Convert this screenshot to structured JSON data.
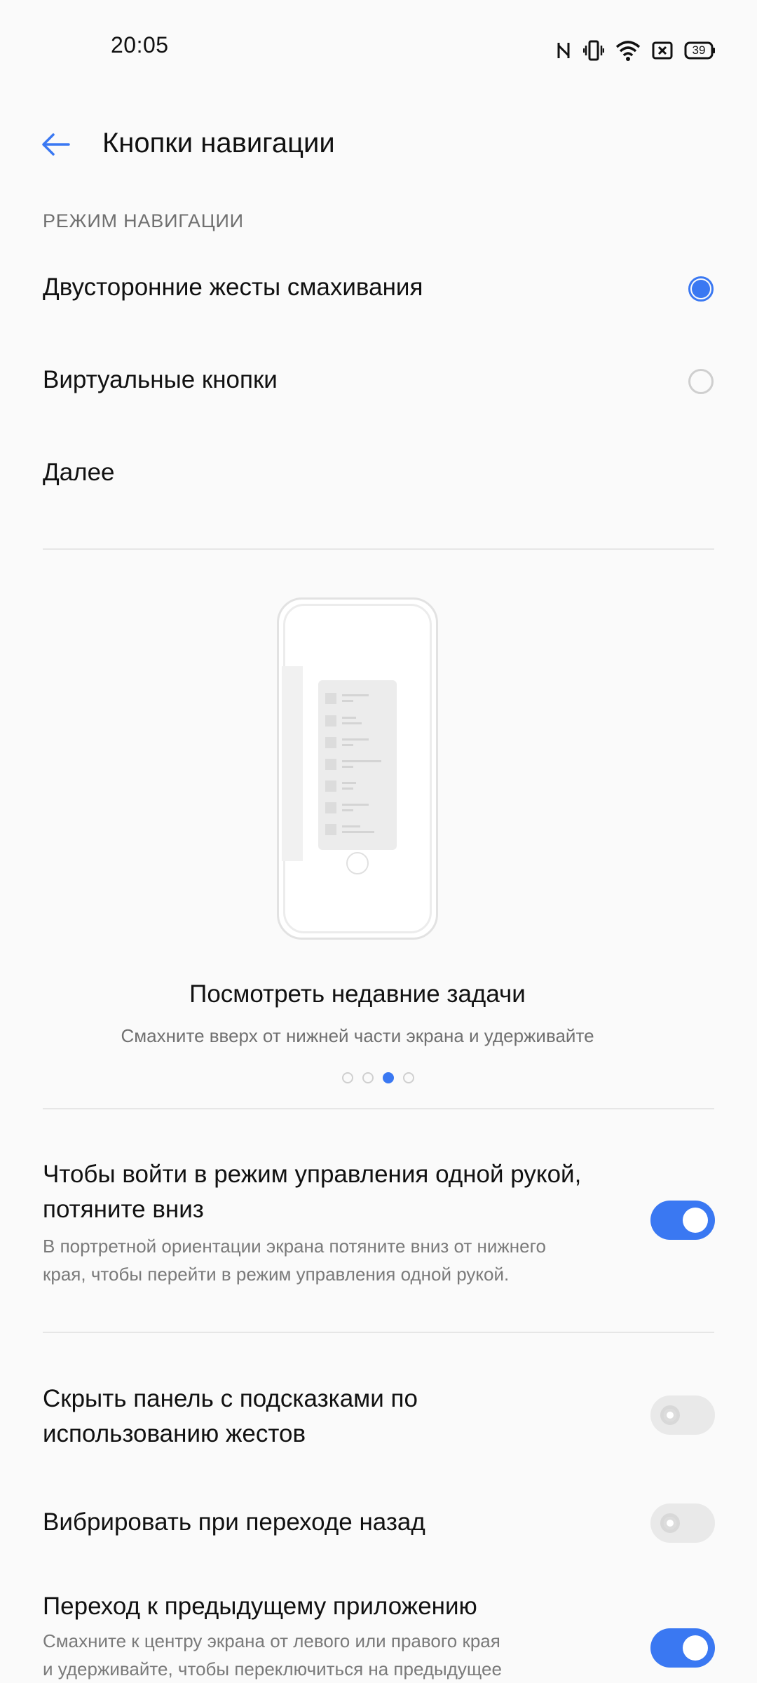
{
  "status": {
    "time": "20:05",
    "battery": "39",
    "icons": [
      "nfc-icon",
      "vibrate-icon",
      "wifi-icon",
      "sim-icon",
      "battery-icon"
    ]
  },
  "header": {
    "title": "Кнопки навигации",
    "back_icon": "back-arrow-icon"
  },
  "navigation_mode": {
    "section": "РЕЖИМ НАВИГАЦИИ",
    "options": [
      {
        "label": "Двусторонние жесты смахивания",
        "selected": true
      },
      {
        "label": "Виртуальные кнопки",
        "selected": false
      }
    ],
    "more": "Далее"
  },
  "illustration": {
    "title": "Посмотреть недавние задачи",
    "subtitle": "Смахните вверх от нижней части экрана и удерживайте",
    "page_count": 4,
    "active_page": 3
  },
  "settings": [
    {
      "title_lines": [
        "Чтобы войти в режим управления одной рукой,",
        "потяните вниз"
      ],
      "subtitle_lines": [
        "В портретной ориентации экрана потяните вниз от нижнего",
        "края, чтобы перейти в режим управления одной рукой."
      ],
      "enabled": true
    },
    {
      "title_lines": [
        "Скрыть панель с подсказками по",
        "использованию жестов"
      ],
      "enabled": false
    },
    {
      "title_lines": [
        "Вибрировать при переходе назад"
      ],
      "enabled": false
    },
    {
      "title_lines": [
        "Переход к предыдущему приложению"
      ],
      "subtitle_lines": [
        "Смахните к центру экрана от левого или правого края",
        "и удерживайте, чтобы переключиться на предыдущее"
      ],
      "enabled": true
    }
  ],
  "colors": {
    "accent": "#3a78f2",
    "background": "#fafafa",
    "secondary_text": "#707070"
  }
}
